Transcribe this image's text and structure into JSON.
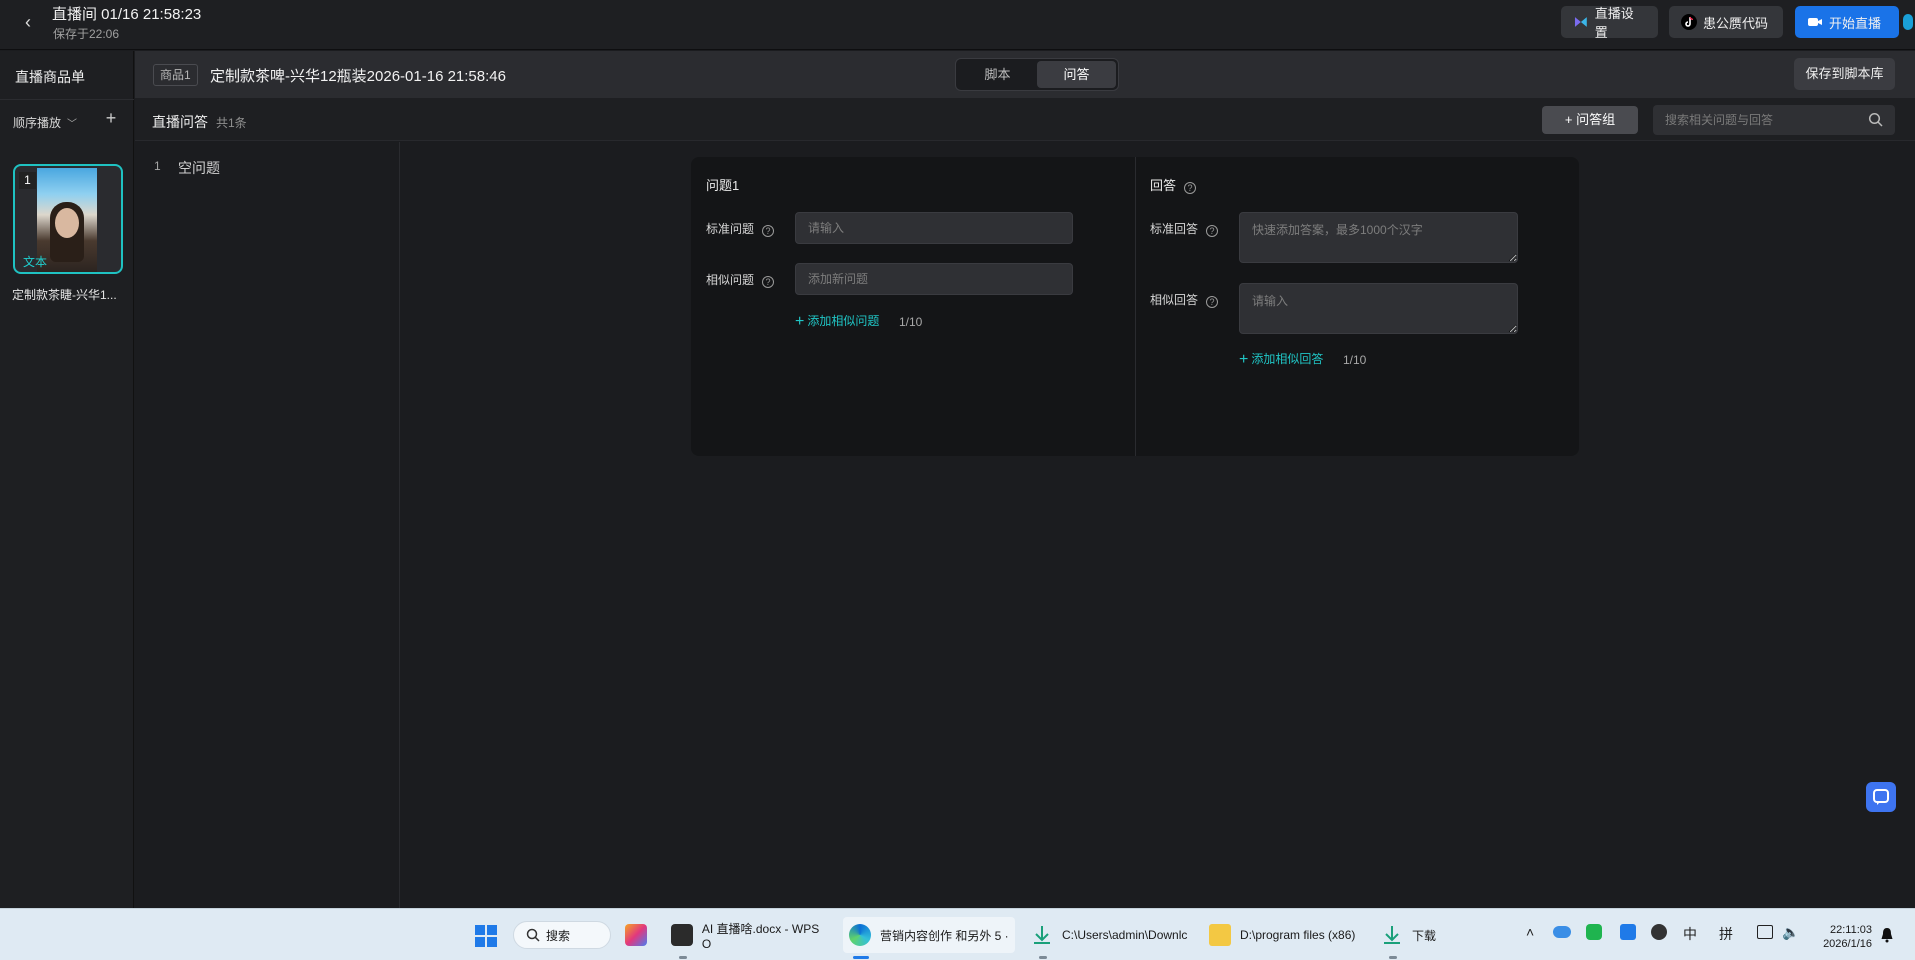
{
  "topbar": {
    "title": "直播间 01/16 21:58:23",
    "save_time": "保存于22:06",
    "settings_label": "直播设置",
    "code_label": "患公赝代码",
    "start_label": "开始直播"
  },
  "sidebar": {
    "title": "直播商品单",
    "play_mode": "顺序播放",
    "products": [
      {
        "index": "1",
        "tag": "文本",
        "name": "定制款茶睫-兴华1..."
      }
    ]
  },
  "content_header": {
    "product_tag": "商品1",
    "product_title": "定制款茶啤-兴华12瓶装2026-01-16 21:58:46",
    "tabs": [
      {
        "label": "脚本",
        "active": false
      },
      {
        "label": "问答",
        "active": true
      }
    ],
    "save_library_label": "保存到脚本库"
  },
  "qa_bar": {
    "title": "直播问答",
    "count": "共1条",
    "add_group_label": "+ 问答组",
    "search_placeholder": "搜索相关问题与回答"
  },
  "qa_list": [
    {
      "num": "1",
      "label": "空问题"
    }
  ],
  "qa_card": {
    "question_title": "问题1",
    "standard_question_label": "标准问题",
    "standard_question_placeholder": "请输入",
    "similar_question_label": "相似问题",
    "similar_question_placeholder": "添加新问题",
    "add_similar_question": "添加相似问题",
    "similar_question_count": "1/10",
    "answer_title": "回答",
    "standard_answer_label": "标准回答",
    "standard_answer_placeholder": "快速添加答案，最多1000个汉字",
    "similar_answer_label": "相似回答",
    "similar_answer_placeholder": "请输入",
    "add_similar_answer": "添加相似回答",
    "similar_answer_count": "1/10"
  },
  "taskbar": {
    "search_label": "搜索",
    "apps": [
      {
        "label": "AI 直播啥.docx - WPS O"
      },
      {
        "label": "营销内容创作 和另外 5 ·"
      },
      {
        "label": "C:\\Users\\admin\\Downlc"
      },
      {
        "label": "D:\\program files (x86)"
      },
      {
        "label": "下载"
      }
    ],
    "ime_lang": "中",
    "ime_mode": "拼",
    "time": "22:11:03",
    "date": "2026/1/16"
  },
  "colors": {
    "accent": "#20c5c5",
    "primary_button": "#1a73e8",
    "background": "#1b1c1f",
    "card": "#141517"
  }
}
